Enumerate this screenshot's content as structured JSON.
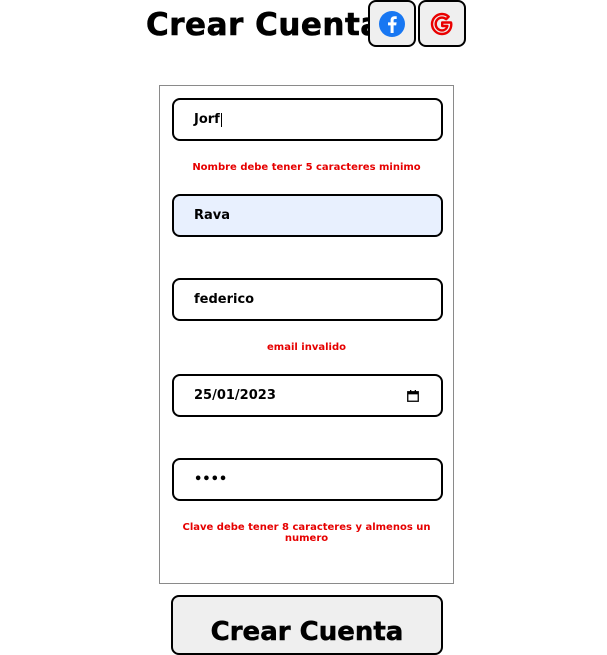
{
  "header": {
    "title": "Crear Cuenta",
    "facebook_icon": "facebook-icon",
    "google_icon": "google-icon",
    "facebook_color": "#1877f2",
    "google_color": "#ea0000"
  },
  "form": {
    "nombre": {
      "value": "Jorf",
      "error": "Nombre debe tener 5 caracteres minimo"
    },
    "apellido": {
      "value": "Rava"
    },
    "email": {
      "value": "federico",
      "error": "email invalido"
    },
    "fecha": {
      "value": "25/01/2023",
      "icon": "calendar-icon"
    },
    "clave": {
      "value": "••••",
      "error": "Clave debe tener 8 caracteres y almenos un numero"
    },
    "error_color": "#e60000",
    "autofill_color": "#e8f0fe"
  },
  "submit": {
    "label": "Crear Cuenta"
  }
}
